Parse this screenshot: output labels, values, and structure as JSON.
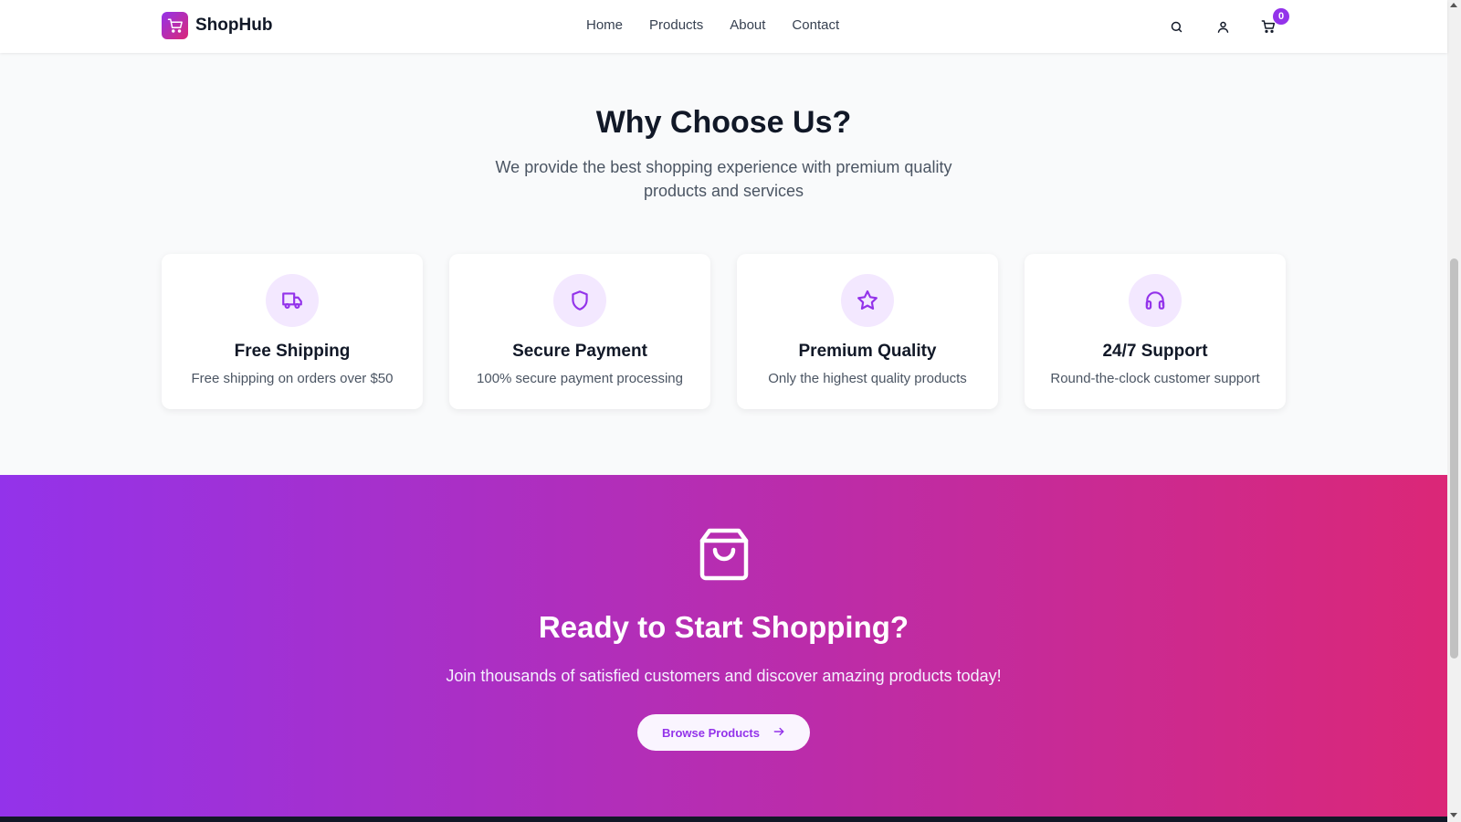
{
  "header": {
    "brand": "ShopHub",
    "nav": [
      "Home",
      "Products",
      "About",
      "Contact"
    ],
    "icons": [
      "search-icon",
      "user-icon",
      "cart-icon"
    ],
    "cart_count": "0"
  },
  "why": {
    "title": "Why Choose Us?",
    "subtitle": "We provide the best shopping experience with premium quality products and services",
    "features": [
      {
        "icon": "truck-icon",
        "title": "Free Shipping",
        "desc": "Free shipping on orders over $50"
      },
      {
        "icon": "shield-icon",
        "title": "Secure Payment",
        "desc": "100% secure payment processing"
      },
      {
        "icon": "star-icon",
        "title": "Premium Quality",
        "desc": "Only the highest quality products"
      },
      {
        "icon": "headphones-icon",
        "title": "24/7 Support",
        "desc": "Round-the-clock customer support"
      }
    ]
  },
  "cta": {
    "icon": "shopping-bag-icon",
    "title": "Ready to Start Shopping?",
    "subtitle": "Join thousands of satisfied customers and discover amazing products today!",
    "button": "Browse Products"
  },
  "colors": {
    "accent": "#9333ea",
    "accent_secondary": "#db2777",
    "icon_bg": "#f3e8ff"
  }
}
